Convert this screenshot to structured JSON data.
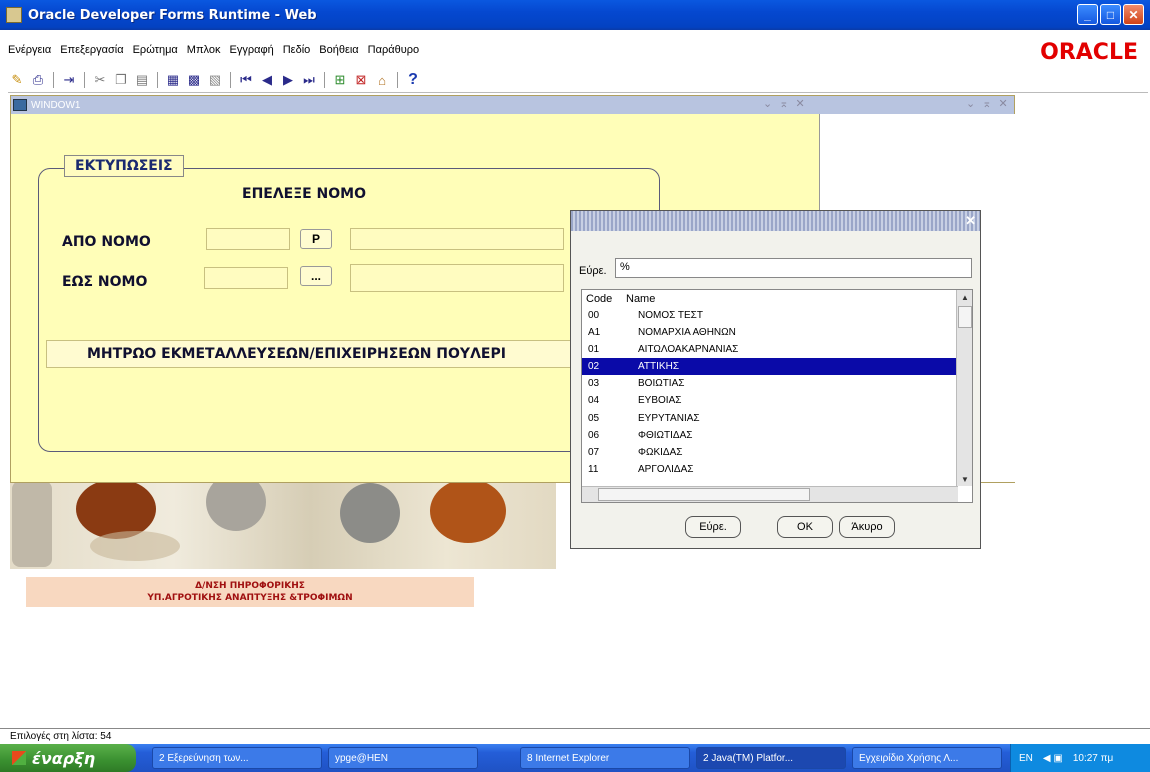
{
  "window": {
    "title": "Oracle Developer Forms Runtime - Web",
    "controls": {
      "minimize": "_",
      "maximize": "□",
      "close": "✕"
    }
  },
  "menu": {
    "items": [
      "Ενέργεια",
      "Επεξεργασία",
      "Ερώτημα",
      "Μπλοκ",
      "Εγγραφή",
      "Πεδίο",
      "Βοήθεια",
      "Παράθυρο"
    ],
    "brand": "ORACLE"
  },
  "toolbar": {
    "icons": [
      "save-icon",
      "print-icon",
      "exit-icon",
      "cut-icon",
      "copy-icon",
      "paste-icon",
      "enter-query-icon",
      "execute-query-icon",
      "cancel-query-icon",
      "first-record-icon",
      "previous-record-icon",
      "next-record-icon",
      "last-record-icon",
      "insert-record-icon",
      "delete-record-icon",
      "lock-record-icon",
      "help-icon"
    ],
    "help": "?"
  },
  "window1": {
    "title": "WINDOW1",
    "controls": "⌄ ⌅ ✕",
    "frame_title": "ΕΚΤΥΠΩΣΕΙΣ",
    "heading": "ΕΠΕΛΕΞΕ ΝΟΜΟ",
    "from_label": "ΑΠΟ ΝΟΜΟ",
    "to_label": "ΕΩΣ ΝΟΜΟ",
    "from_button": "P",
    "to_button": "...",
    "report_button": "ΜΗΤΡΩΟ ΕΚΜΕΤΑΛΛΕΥΣΕΩΝ/ΕΠΙΧΕΙΡΗΣΕΩΝ ΠΟΥΛΕΡΙ"
  },
  "credit": {
    "line1": "Δ/ΝΣΗ ΠΗΡΟΦΟΡΙΚΗΣ",
    "line2": "ΥΠ.ΑΓΡΟΤΙΚΗΣ ΑΝΑΠΤΥΞΗΣ &ΤΡΟΦΙΜΩΝ"
  },
  "lov": {
    "find_label": "Εύρε.",
    "find_value": "%",
    "columns": [
      "Code",
      "Name"
    ],
    "rows": [
      {
        "code": "00",
        "name": "ΝΟΜΟΣ ΤΕΣΤ"
      },
      {
        "code": "A1",
        "name": "ΝΟΜΑΡΧΙΑ ΑΘΗΝΩΝ"
      },
      {
        "code": "01",
        "name": "ΑΙΤΩΛΟΑΚΑΡΝΑΝΙΑΣ"
      },
      {
        "code": "02",
        "name": "ΑΤΤΙΚΗΣ"
      },
      {
        "code": "03",
        "name": "ΒΟΙΩΤΙΑΣ"
      },
      {
        "code": "04",
        "name": "ΕΥΒΟΙΑΣ"
      },
      {
        "code": "05",
        "name": "ΕΥΡΥΤΑΝΙΑΣ"
      },
      {
        "code": "06",
        "name": "ΦΘΙΩΤΙΔΑΣ"
      },
      {
        "code": "07",
        "name": "ΦΩΚΙΔΑΣ"
      },
      {
        "code": "11",
        "name": "ΑΡΓΟΛΙΔΑΣ"
      }
    ],
    "selected_index": 3,
    "buttons": {
      "find": "Εύρε.",
      "ok": "OK",
      "cancel": "Άκυρο"
    }
  },
  "status": {
    "text": "Επιλογές στη λίστα: 54"
  },
  "taskbar": {
    "start": "έναρξη",
    "tasks": [
      "2 Εξερεύνηση των...",
      "ypge@HEN",
      "8 Internet Explorer",
      "2 Java(TM) Platfor...",
      "Εγχειρίδιο Χρήσης Λ..."
    ],
    "lang": "EN",
    "clock": "10:27 πμ"
  },
  "colors": {
    "titlebar": "#0548d0",
    "form_background": "#fffeb8",
    "selection": "#0a0aa8",
    "oracle_red": "#e20000",
    "taskbar": "#245ed8"
  }
}
